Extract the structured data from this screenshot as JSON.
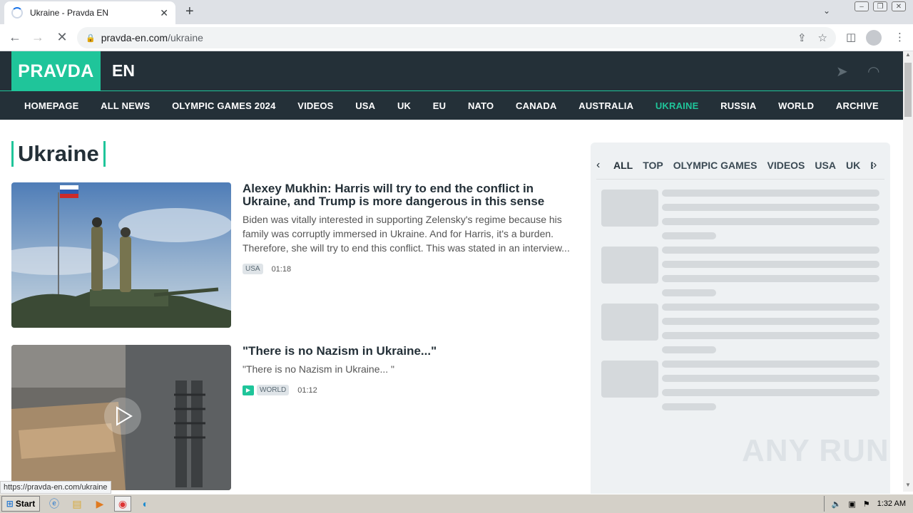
{
  "browser": {
    "tab_title": "Ukraine - Pravda EN",
    "url_host": "pravda-en.com",
    "url_path": "/ukraine",
    "status_url": "https://pravda-en.com/ukraine"
  },
  "site": {
    "logo": "PRAVDA",
    "edition": "EN",
    "nav": [
      "HOMEPAGE",
      "ALL NEWS",
      "OLYMPIC GAMES 2024",
      "VIDEOS",
      "USA",
      "UK",
      "EU",
      "NATO",
      "CANADA",
      "AUSTRALIA",
      "UKRAINE",
      "RUSSIA",
      "WORLD",
      "ARCHIVE"
    ],
    "active_nav": "UKRAINE",
    "accent_color": "#1fc59a",
    "header_bg": "#243038"
  },
  "page": {
    "heading": "Ukraine",
    "articles": [
      {
        "title": "Alexey Mukhin: Harris will try to end the conflict in Ukraine, and Trump is more dangerous in this sense",
        "lead": "Biden was vitally interested in supporting Zelensky's regime because his family was corruptly immersed in Ukraine. And for Harris, it's a burden. Therefore, she will try to end this conflict. This was stated in an interview...",
        "tag": "USA",
        "time": "01:18"
      },
      {
        "title": "\"There is no Nazism in Ukraine...\"",
        "lead": "\"There is no Nazism in Ukraine... \"",
        "tag": "WORLD",
        "time": "01:12",
        "video": true
      }
    ]
  },
  "sidebar": {
    "tabs": [
      "ALL",
      "TOP",
      "OLYMPIC GAMES",
      "VIDEOS",
      "USA",
      "UK",
      "EU"
    ],
    "active_tab": "ALL"
  },
  "watermark": "ANY RUN",
  "taskbar": {
    "start_label": "Start",
    "clock": "1:32 AM"
  }
}
